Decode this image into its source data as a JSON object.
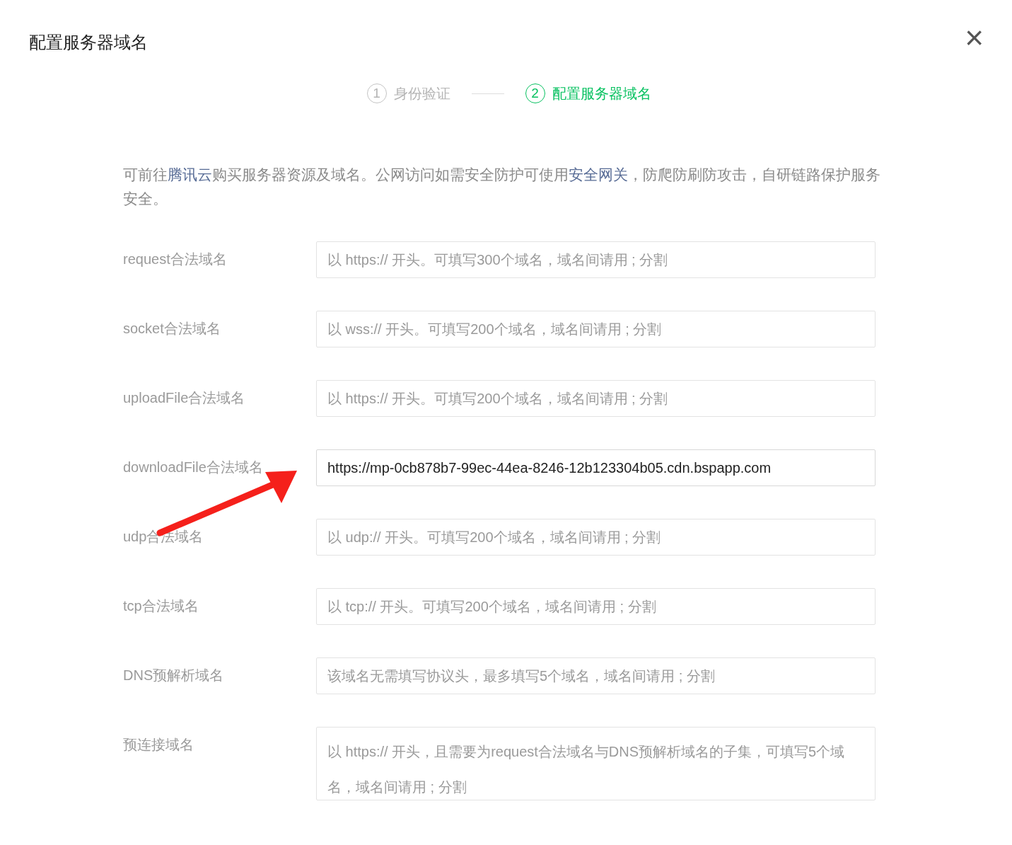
{
  "dialog": {
    "title": "配置服务器域名",
    "close": "×"
  },
  "steps": [
    {
      "number": "1",
      "label": "身份验证",
      "selected": false
    },
    {
      "number": "2",
      "label": "配置服务器域名",
      "selected": true
    }
  ],
  "description": [
    {
      "text": "可前往",
      "link": false
    },
    {
      "text": "腾讯云",
      "link": true
    },
    {
      "text": "购买服务器资源及域名。公网访问如需安全防护可使用",
      "link": false
    },
    {
      "text": "安全网关",
      "link": true
    },
    {
      "text": "，防爬防刷防攻击，自研链路保护服务安全。",
      "link": false
    }
  ],
  "fields": [
    {
      "label": "request合法域名",
      "kind": "input",
      "placeholder": "以 https:// 开头。可填写300个域名，域名间请用 ; 分割"
    },
    {
      "label": "socket合法域名",
      "kind": "input",
      "placeholder": "以 wss:// 开头。可填写200个域名，域名间请用 ; 分割"
    },
    {
      "label": "uploadFile合法域名",
      "kind": "input",
      "placeholder": "以 https:// 开头。可填写200个域名，域名间请用 ; 分割"
    },
    {
      "label": "downloadFile合法域名",
      "kind": "input",
      "value": "https://mp-0cb878b7-99ec-44ea-8246-12b123304b05.cdn.bspapp.com"
    },
    {
      "label": "udp合法域名",
      "kind": "input",
      "placeholder": "以 udp:// 开头。可填写200个域名，域名间请用 ; 分割"
    },
    {
      "label": "tcp合法域名",
      "kind": "input",
      "placeholder": "以 tcp:// 开头。可填写200个域名，域名间请用 ; 分割"
    },
    {
      "label": "DNS预解析域名",
      "kind": "input",
      "placeholder": "该域名无需填写协议头，最多填写5个域名，域名间请用 ; 分割"
    },
    {
      "label": "预连接域名",
      "kind": "textarea",
      "placeholder": "以 https:// 开头，且需要为request合法域名与DNS预解析域名的子集，可填写5个域名，域名间请用 ; 分割"
    }
  ]
}
